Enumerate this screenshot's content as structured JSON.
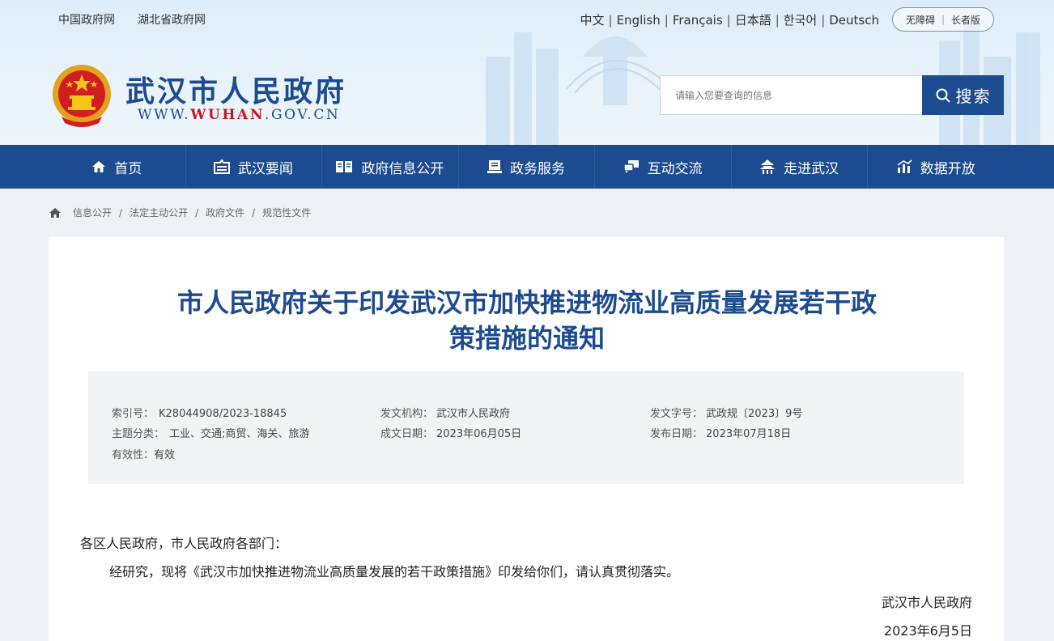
{
  "header": {
    "top_links": [
      "中国政府网",
      "湖北省政府网"
    ],
    "languages": [
      "中文",
      "English",
      "Français",
      "日本語",
      "한국어",
      "Deutsch"
    ],
    "accessibility": {
      "barrier_free": "无障碍",
      "elder": "长者版"
    },
    "site_title": "武汉市人民政府",
    "site_url": {
      "prefix": "WWW.",
      "highlight": "WUHAN",
      "suffix": ".GOV.CN"
    },
    "search": {
      "placeholder": "请输入您要查询的信息",
      "button_label": "搜索"
    }
  },
  "nav": [
    {
      "label": "首页",
      "icon": "home-icon"
    },
    {
      "label": "武汉要闻",
      "icon": "news-icon"
    },
    {
      "label": "政府信息公开",
      "icon": "open-book-icon"
    },
    {
      "label": "政务服务",
      "icon": "service-icon"
    },
    {
      "label": "互动交流",
      "icon": "chat-icon"
    },
    {
      "label": "走进武汉",
      "icon": "pavilion-icon"
    },
    {
      "label": "数据开放",
      "icon": "data-chart-icon"
    }
  ],
  "breadcrumb": [
    "信息公开",
    "法定主动公开",
    "政府文件",
    "规范性文件"
  ],
  "document": {
    "title_line1": "市人民政府关于印发武汉市加快推进物流业高质量发展若干政",
    "title_line2": "策措施的通知",
    "meta": {
      "index_label": "索引号：",
      "index_value": "K28044908/2023-18845",
      "issuer_label": "发文机构：",
      "issuer_value": "武汉市人民政府",
      "doc_no_label": "发文字号：",
      "doc_no_value": "武政规〔2023〕9号",
      "topic_label": "主题分类：",
      "topic_value": "工业、交通;商贸、海关、旅游",
      "created_label": "成文日期：",
      "created_value": "2023年06月05日",
      "published_label": "发布日期：",
      "published_value": "2023年07月18日",
      "validity_label": "有效性：",
      "validity_value": "有效"
    },
    "salutation": "各区人民政府，市人民政府各部门：",
    "paragraph": "经研究，现将《武汉市加快推进物流业高质量发展的若干政策措施》印发给你们，请认真贯彻落实。",
    "signature": "武汉市人民政府",
    "date": "2023年6月5日"
  },
  "colors": {
    "brand": "#1d4b8f",
    "accent_red": "#c8161d",
    "meta_bg": "#f2f3f5"
  }
}
